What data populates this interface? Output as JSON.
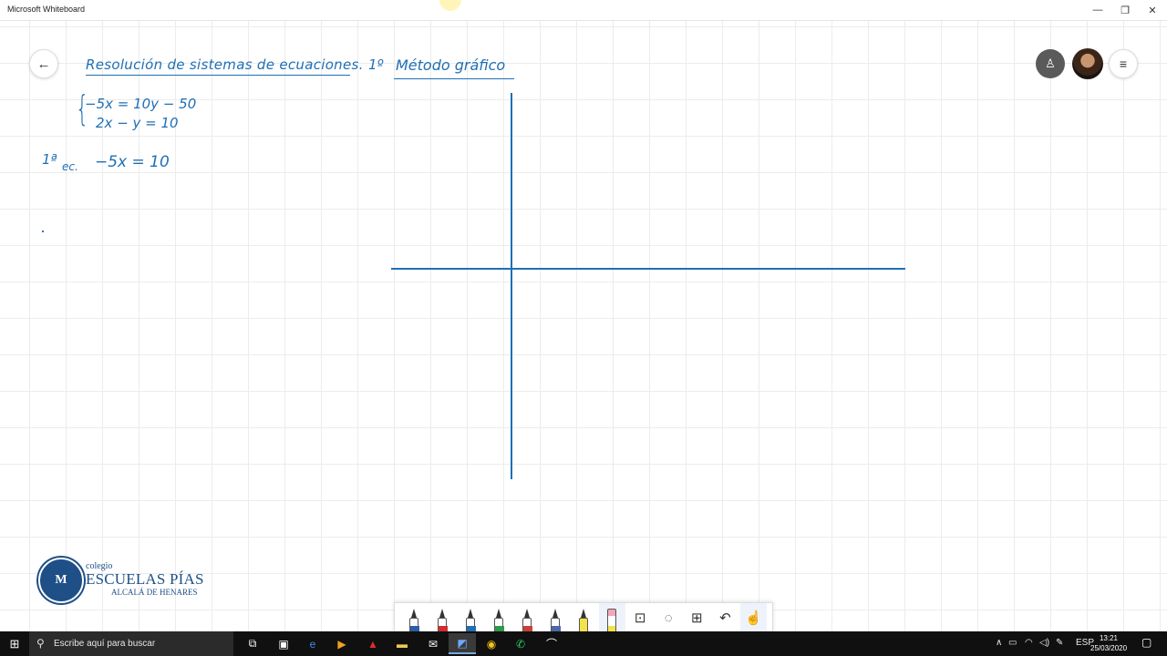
{
  "window": {
    "title": "Microsoft Whiteboard",
    "controls": {
      "minimize": "—",
      "restore": "❐",
      "close": "✕"
    }
  },
  "board": {
    "heading": "Resolución de sistemas de ecuaciones.",
    "method_number": "1º",
    "method_name": "Método gráfico",
    "brace": "{",
    "equation_1": "−5x = 10y − 50",
    "equation_2": "2x − y = 10",
    "step_label": "1ª",
    "step_sub": "ec.",
    "step_equation": "−5x = 10",
    "ink_color": "#1f6fb5"
  },
  "top_right": {
    "back_icon": "←",
    "people_icon": "♙",
    "menu_icon": "≡"
  },
  "logo": {
    "line1": "colegio",
    "line2": "ESCUELAS PÍAS",
    "line3": "ALCALÁ DE HENARES",
    "seal": "M"
  },
  "toolbar": {
    "pens": [
      {
        "name": "pen-black",
        "color": "#2a5ea8"
      },
      {
        "name": "pen-red",
        "color": "#d22c2c"
      },
      {
        "name": "pen-blue",
        "color": "#1f6fb5"
      },
      {
        "name": "pen-green",
        "color": "#2e9a4a"
      },
      {
        "name": "pen-red-2",
        "color": "#c9403a"
      },
      {
        "name": "pen-purple",
        "color": "#4c68a8"
      }
    ],
    "highlighter_color": "#f3e34a",
    "eraser_color": "#f4a6b8",
    "icons": {
      "ruler": "⊡",
      "lasso": "◌",
      "add": "⊞",
      "undo": "↶",
      "touch": "☝"
    }
  },
  "taskbar": {
    "start_icon": "⊞",
    "search_icon": "⚲",
    "search_placeholder": "Escribe aquí para buscar",
    "tray_language": "ESP",
    "time": "13:21",
    "date": "25/03/2020"
  }
}
